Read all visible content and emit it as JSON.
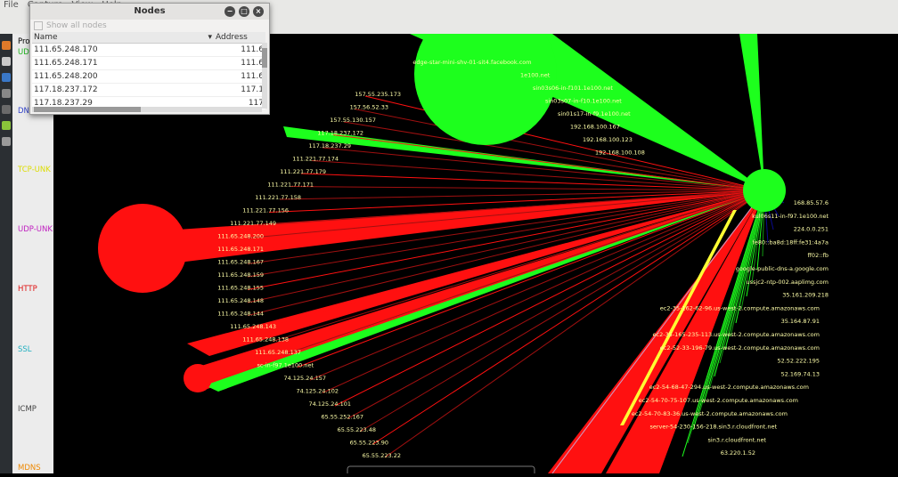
{
  "menu": [
    "File",
    "Capture",
    "View",
    "Help"
  ],
  "legend": [
    {
      "label": "Pro",
      "color": "#555555"
    },
    {
      "label": "UDP",
      "color": "#1db31d"
    },
    {
      "label": "DNS",
      "color": "#3344cc"
    },
    {
      "label": "TCP-UNK",
      "color": "#dddd00"
    },
    {
      "label": "UDP-UNK",
      "color": "#c020c0"
    },
    {
      "label": "HTTP",
      "color": "#e01010"
    },
    {
      "label": "SSL",
      "color": "#20b0c0"
    },
    {
      "label": "ICMP",
      "color": "#444444"
    },
    {
      "label": "MDNS",
      "color": "#ee8800"
    }
  ],
  "nodes_window": {
    "title": "Nodes",
    "show_all": "Show all nodes",
    "col_name": "Name",
    "col_address": "Address",
    "rows": [
      {
        "name": "111.65.248.170",
        "address": "111.6"
      },
      {
        "name": "111.65.248.171",
        "address": "111.6"
      },
      {
        "name": "111.65.248.200",
        "address": "111.6"
      },
      {
        "name": "117.18.237.172",
        "address": "117.1"
      },
      {
        "name": "117.18.237.29",
        "address": "117"
      }
    ]
  },
  "graph": {
    "hub_label": "",
    "left_labels": [
      "157.55.235.173",
      "157.56.52.33",
      "157.55.130.157",
      "117.18.237.172",
      "117.18.237.29",
      "111.221.77.174",
      "111.221.77.179",
      "111.221.77.171",
      "111.221.77.158",
      "111.221.77.156",
      "111.221.77.149",
      "111.65.248.200",
      "111.65.248.171",
      "111.65.248.167",
      "111.65.248.159",
      "111.65.248.155",
      "111.65.248.148",
      "111.65.248.144",
      "111.65.248.143",
      "111.65.248.138",
      "111.65.248.137",
      "sc-in-f97.1e100.net",
      "74.125.24.157",
      "74.125.24.102",
      "74.125.24.101",
      "65.55.252.167",
      "65.55.223.48",
      "65.55.223.90",
      "65.55.223.22"
    ],
    "right_labels": [
      "168.85.57.6",
      "kul06s11-in-f97.1e100.net",
      "224.0.0.251",
      "fe80::ba8d:18ff:fe31:4a7a",
      "ff02::fb",
      "google-public-dns-a.google.com",
      "ussjc2-ntp-002.aaplimg.com",
      "35.161.209.218",
      "ec2-35-162-62-96.us-west-2.compute.amazonaws.com",
      "35.164.87.91",
      "ec2-35-165-235-113.us-west-2.compute.amazonaws.com",
      "ec2-52-33-196-79.us-west-2.compute.amazonaws.com",
      "52.52.222.195",
      "52.169.74.13",
      "ec2-54-68-47-294.us-west-2.compute.amazonaws.com",
      "ec2-54-70-75-107.us-west-2.compute.amazonaws.com",
      "ec2-54-70-83-36.us-west-2.compute.amazonaws.com",
      "server-54-230-156-218.sin3.r.cloudfront.net",
      "sin3.r.cloudfront.net",
      "63.220.1.52"
    ],
    "top_labels": [
      "edge-star-mini-shv-01-sit4.facebook.com",
      "1e100.net",
      "sin03s06-in-f101.1e100.net",
      "sin03s07-in-f10.1e100.net",
      "sin01s17-in-f9.1e100.net",
      "192.168.100.167",
      "192.168.100.123",
      "192.168.100.108"
    ]
  }
}
